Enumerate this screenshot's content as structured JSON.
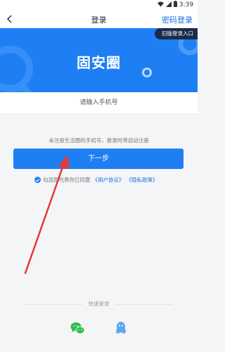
{
  "status_bar": {
    "time": "3:39"
  },
  "nav": {
    "title": "登录",
    "password_login": "密码登录"
  },
  "banner": {
    "logo_text": "固安圈",
    "old_entry": "旧版登录入口"
  },
  "phone": {
    "placeholder": "请输入手机号"
  },
  "hint": "未注册生活圈的手机号，登录时将自动注册",
  "next_button": "下一步",
  "agreement": {
    "prefix": "勾选即代表你已同意",
    "user_agreement": "《用户协议》",
    "privacy_policy": "《隐私政策》"
  },
  "quick_login": {
    "title": "快速登录"
  },
  "colors": {
    "brand_blue": "#1e7ff4",
    "annotation_arrow": "#e53935"
  }
}
